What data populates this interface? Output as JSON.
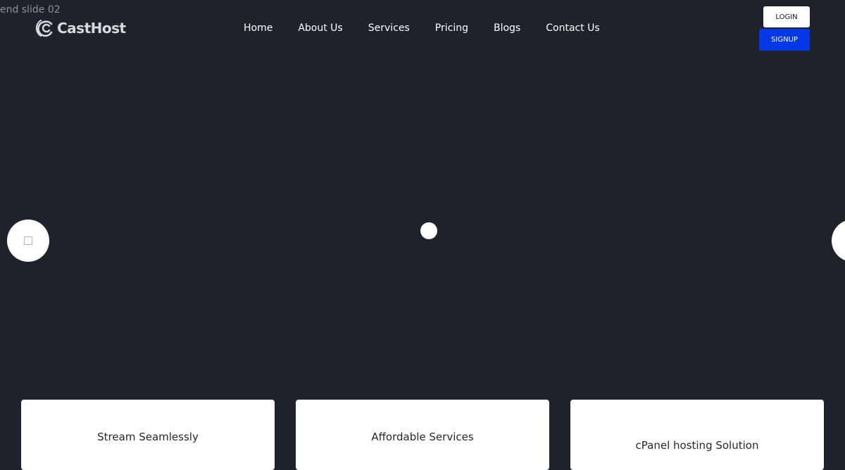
{
  "debug_label": "end slide 02",
  "brand": {
    "name": "CastHost",
    "logo_icon": "broadcast-c-icon"
  },
  "nav": {
    "items": [
      {
        "label": "Home"
      },
      {
        "label": "About Us"
      },
      {
        "label": "Services"
      },
      {
        "label": "Pricing"
      },
      {
        "label": "Blogs"
      },
      {
        "label": "Contact Us"
      }
    ]
  },
  "auth": {
    "login_label": "LOGIN",
    "signup_label": "SIGNUP"
  },
  "colors": {
    "background": "#1f222b",
    "signup_accent": "#0438e6"
  },
  "slider": {
    "prev_icon": "square-icon",
    "next_icon": "arrow-next-icon",
    "active_dot": 1
  },
  "features": [
    {
      "title": "Stream Seamlessly"
    },
    {
      "title": "Affordable Services"
    },
    {
      "title": "cPanel hosting Solution"
    }
  ]
}
